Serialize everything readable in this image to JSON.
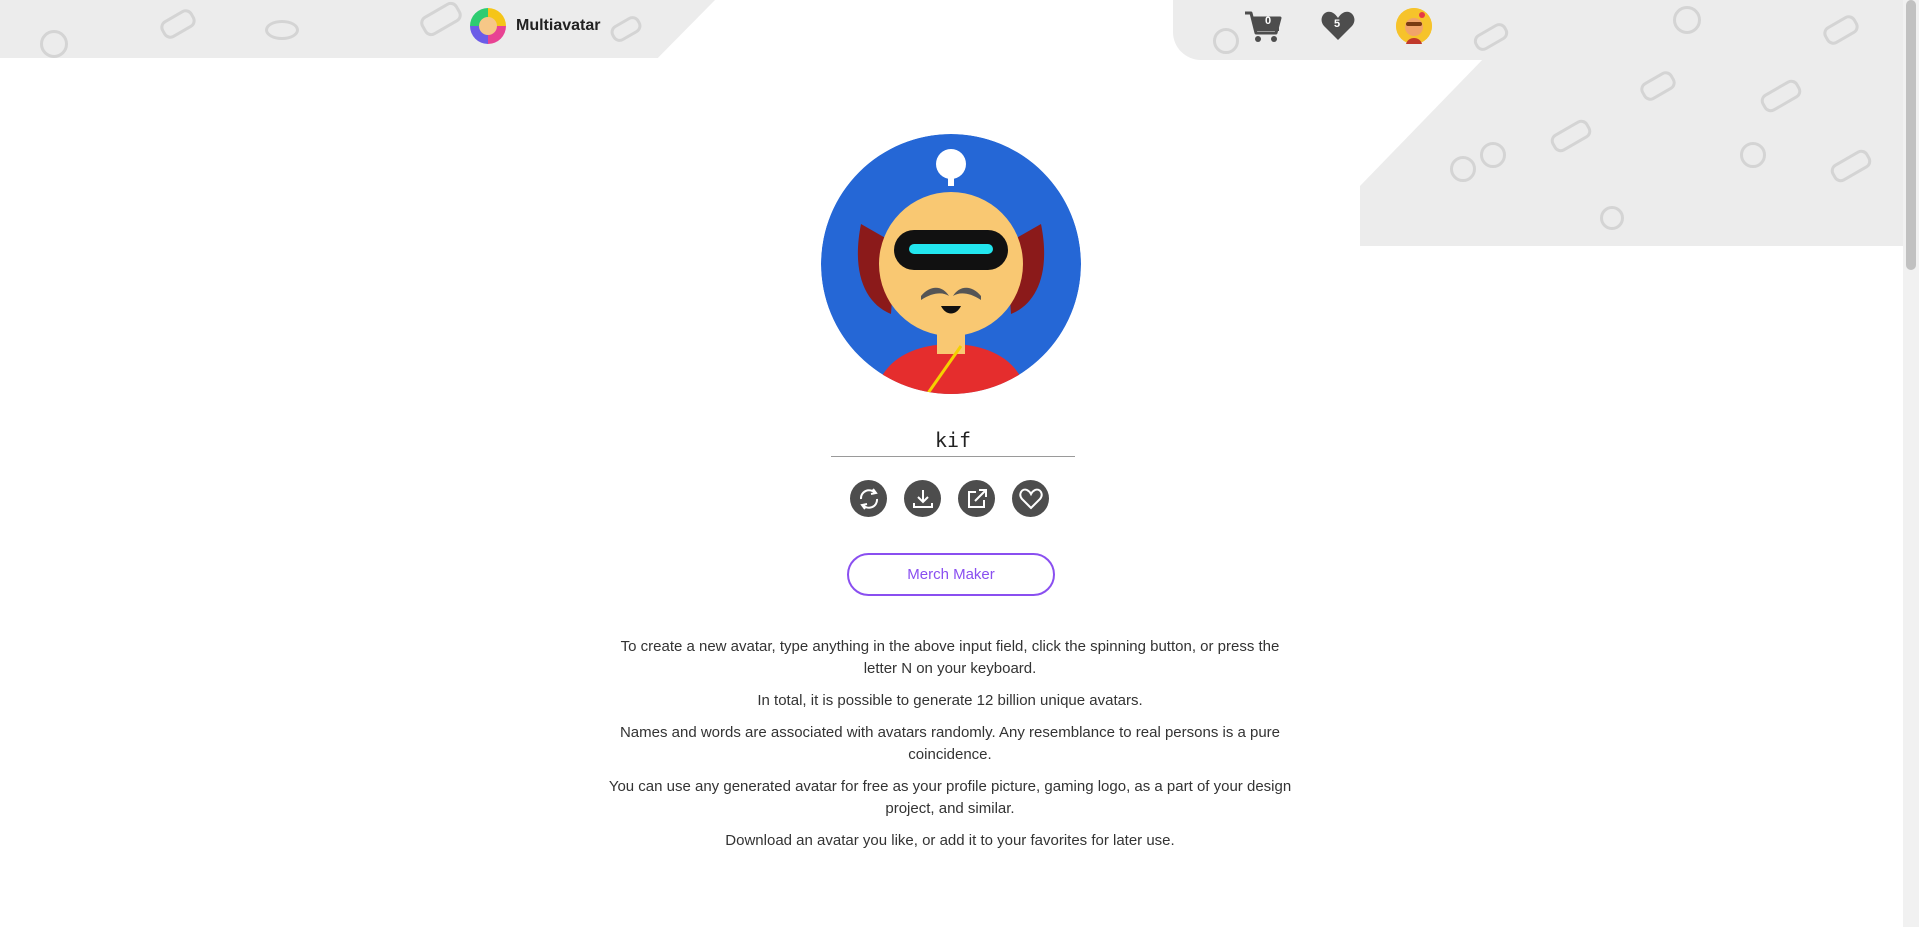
{
  "header": {
    "brand_name": "Multiavatar",
    "cart_count": "0",
    "favorites_count": "5"
  },
  "avatar": {
    "name_value": "kif",
    "name_placeholder": ""
  },
  "actions": [
    {
      "name": "refresh-icon"
    },
    {
      "name": "download-icon"
    },
    {
      "name": "external-link-icon"
    },
    {
      "name": "heart-icon"
    }
  ],
  "merch_label": "Merch Maker",
  "info": {
    "p1": "To create a new avatar, type anything in the above input field, click the spinning button, or press the letter N on your keyboard.",
    "p2": "In total, it is possible to generate 12 billion unique avatars.",
    "p3": "Names and words are associated with avatars randomly. Any resemblance to real persons is a pure coincidence.",
    "p4": "You can use any generated avatar for free as your profile picture, gaming logo, as a part of your design project, and similar.",
    "p5": "Download an avatar you like, or add it to your favorites for later use."
  },
  "colors": {
    "accent": "#8a4ff0",
    "avatar_bg": "#2567d6",
    "button_dark": "#4d4d4d",
    "bg_grey": "#ececec"
  }
}
